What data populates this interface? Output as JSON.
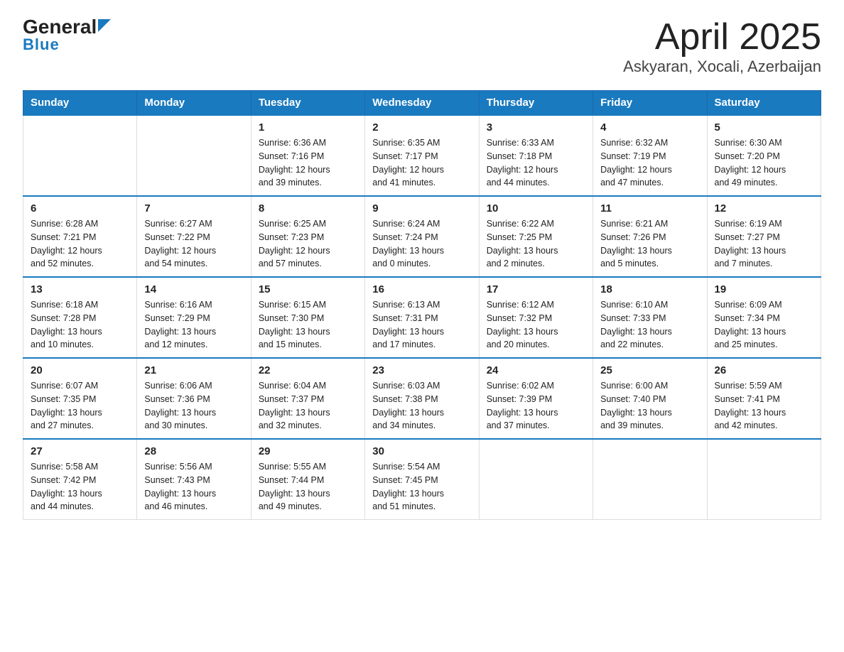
{
  "header": {
    "logo_general": "General",
    "logo_blue": "Blue",
    "title": "April 2025",
    "subtitle": "Askyaran, Xocali, Azerbaijan"
  },
  "days_of_week": [
    "Sunday",
    "Monday",
    "Tuesday",
    "Wednesday",
    "Thursday",
    "Friday",
    "Saturday"
  ],
  "weeks": [
    [
      {
        "day": "",
        "info": ""
      },
      {
        "day": "",
        "info": ""
      },
      {
        "day": "1",
        "info": "Sunrise: 6:36 AM\nSunset: 7:16 PM\nDaylight: 12 hours\nand 39 minutes."
      },
      {
        "day": "2",
        "info": "Sunrise: 6:35 AM\nSunset: 7:17 PM\nDaylight: 12 hours\nand 41 minutes."
      },
      {
        "day": "3",
        "info": "Sunrise: 6:33 AM\nSunset: 7:18 PM\nDaylight: 12 hours\nand 44 minutes."
      },
      {
        "day": "4",
        "info": "Sunrise: 6:32 AM\nSunset: 7:19 PM\nDaylight: 12 hours\nand 47 minutes."
      },
      {
        "day": "5",
        "info": "Sunrise: 6:30 AM\nSunset: 7:20 PM\nDaylight: 12 hours\nand 49 minutes."
      }
    ],
    [
      {
        "day": "6",
        "info": "Sunrise: 6:28 AM\nSunset: 7:21 PM\nDaylight: 12 hours\nand 52 minutes."
      },
      {
        "day": "7",
        "info": "Sunrise: 6:27 AM\nSunset: 7:22 PM\nDaylight: 12 hours\nand 54 minutes."
      },
      {
        "day": "8",
        "info": "Sunrise: 6:25 AM\nSunset: 7:23 PM\nDaylight: 12 hours\nand 57 minutes."
      },
      {
        "day": "9",
        "info": "Sunrise: 6:24 AM\nSunset: 7:24 PM\nDaylight: 13 hours\nand 0 minutes."
      },
      {
        "day": "10",
        "info": "Sunrise: 6:22 AM\nSunset: 7:25 PM\nDaylight: 13 hours\nand 2 minutes."
      },
      {
        "day": "11",
        "info": "Sunrise: 6:21 AM\nSunset: 7:26 PM\nDaylight: 13 hours\nand 5 minutes."
      },
      {
        "day": "12",
        "info": "Sunrise: 6:19 AM\nSunset: 7:27 PM\nDaylight: 13 hours\nand 7 minutes."
      }
    ],
    [
      {
        "day": "13",
        "info": "Sunrise: 6:18 AM\nSunset: 7:28 PM\nDaylight: 13 hours\nand 10 minutes."
      },
      {
        "day": "14",
        "info": "Sunrise: 6:16 AM\nSunset: 7:29 PM\nDaylight: 13 hours\nand 12 minutes."
      },
      {
        "day": "15",
        "info": "Sunrise: 6:15 AM\nSunset: 7:30 PM\nDaylight: 13 hours\nand 15 minutes."
      },
      {
        "day": "16",
        "info": "Sunrise: 6:13 AM\nSunset: 7:31 PM\nDaylight: 13 hours\nand 17 minutes."
      },
      {
        "day": "17",
        "info": "Sunrise: 6:12 AM\nSunset: 7:32 PM\nDaylight: 13 hours\nand 20 minutes."
      },
      {
        "day": "18",
        "info": "Sunrise: 6:10 AM\nSunset: 7:33 PM\nDaylight: 13 hours\nand 22 minutes."
      },
      {
        "day": "19",
        "info": "Sunrise: 6:09 AM\nSunset: 7:34 PM\nDaylight: 13 hours\nand 25 minutes."
      }
    ],
    [
      {
        "day": "20",
        "info": "Sunrise: 6:07 AM\nSunset: 7:35 PM\nDaylight: 13 hours\nand 27 minutes."
      },
      {
        "day": "21",
        "info": "Sunrise: 6:06 AM\nSunset: 7:36 PM\nDaylight: 13 hours\nand 30 minutes."
      },
      {
        "day": "22",
        "info": "Sunrise: 6:04 AM\nSunset: 7:37 PM\nDaylight: 13 hours\nand 32 minutes."
      },
      {
        "day": "23",
        "info": "Sunrise: 6:03 AM\nSunset: 7:38 PM\nDaylight: 13 hours\nand 34 minutes."
      },
      {
        "day": "24",
        "info": "Sunrise: 6:02 AM\nSunset: 7:39 PM\nDaylight: 13 hours\nand 37 minutes."
      },
      {
        "day": "25",
        "info": "Sunrise: 6:00 AM\nSunset: 7:40 PM\nDaylight: 13 hours\nand 39 minutes."
      },
      {
        "day": "26",
        "info": "Sunrise: 5:59 AM\nSunset: 7:41 PM\nDaylight: 13 hours\nand 42 minutes."
      }
    ],
    [
      {
        "day": "27",
        "info": "Sunrise: 5:58 AM\nSunset: 7:42 PM\nDaylight: 13 hours\nand 44 minutes."
      },
      {
        "day": "28",
        "info": "Sunrise: 5:56 AM\nSunset: 7:43 PM\nDaylight: 13 hours\nand 46 minutes."
      },
      {
        "day": "29",
        "info": "Sunrise: 5:55 AM\nSunset: 7:44 PM\nDaylight: 13 hours\nand 49 minutes."
      },
      {
        "day": "30",
        "info": "Sunrise: 5:54 AM\nSunset: 7:45 PM\nDaylight: 13 hours\nand 51 minutes."
      },
      {
        "day": "",
        "info": ""
      },
      {
        "day": "",
        "info": ""
      },
      {
        "day": "",
        "info": ""
      }
    ]
  ]
}
